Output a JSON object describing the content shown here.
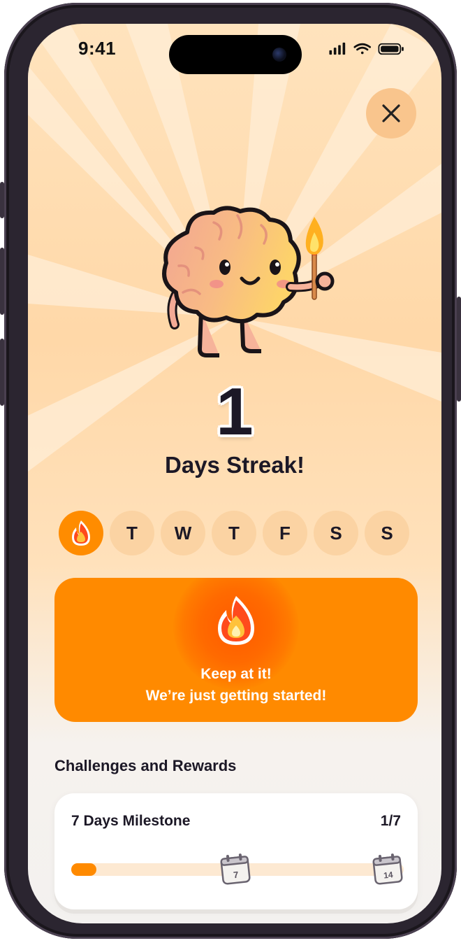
{
  "status": {
    "time": "9:41"
  },
  "colors": {
    "accent": "#ff8a00",
    "bubble": "#fbd3a3",
    "text": "#1c1826"
  },
  "streak": {
    "count": "1",
    "label": "Days Streak!"
  },
  "week": [
    {
      "label": "",
      "icon": "fire-icon",
      "done": true
    },
    {
      "label": "T",
      "done": false
    },
    {
      "label": "W",
      "done": false
    },
    {
      "label": "T",
      "done": false
    },
    {
      "label": "F",
      "done": false
    },
    {
      "label": "S",
      "done": false
    },
    {
      "label": "S",
      "done": false
    }
  ],
  "banner": {
    "line1": "Keep at it!",
    "line2": "We’re just getting started!"
  },
  "challenges": {
    "title": "Challenges and Rewards",
    "milestone": {
      "title": "7 Days Milestone",
      "count": "1/7",
      "progress": 0.076,
      "markers": [
        "7",
        "14"
      ]
    }
  }
}
